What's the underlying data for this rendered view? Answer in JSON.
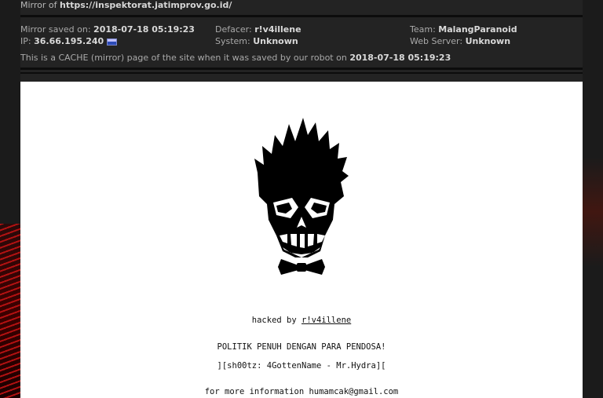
{
  "mirror": {
    "prefix": "Mirror of ",
    "url": "https://inspektorat.jatimprov.go.id/"
  },
  "meta": {
    "saved_label": "Mirror saved on: ",
    "saved_value": "2018-07-18 05:19:23",
    "ip_label": "IP: ",
    "ip_value": "36.66.195.240",
    "defacer_label": "Defacer: ",
    "defacer_value": "r!v4illene",
    "system_label": "System: ",
    "system_value": "Unknown",
    "team_label": "Team: ",
    "team_value": "MalangParanoid",
    "webserver_label": "Web Server: ",
    "webserver_value": "Unknown",
    "cache_text": "This is a CACHE (mirror) page of the site when it was saved by our robot on ",
    "cache_date": "2018-07-18 05:19:23"
  },
  "page": {
    "hacked_prefix": "hacked by ",
    "hacked_name": "r!v4illene",
    "slogan": "POLITIK PENUH DENGAN PARA PENDOSA!",
    "shoutz": "][sh00tz: 4GottenName - Mr.Hydra][",
    "contact": "for more information humamcak@gmail.com"
  },
  "icons": {
    "flag": "indonesia-flag-icon",
    "skull": "skull-bowtie-logo"
  },
  "colors": {
    "background": "#1b1b1b",
    "frame": "#232323",
    "content": "#ffffff"
  }
}
